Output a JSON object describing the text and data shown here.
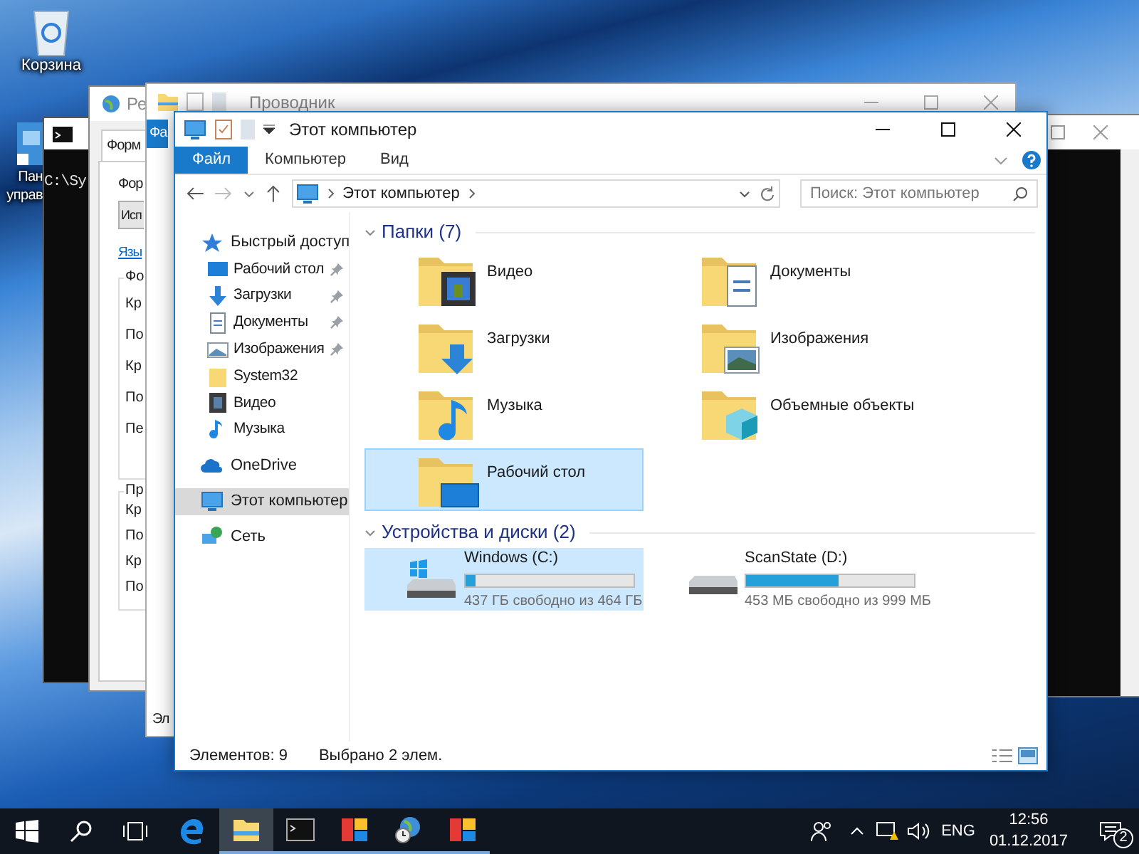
{
  "desktop_icons": [
    {
      "kind": "recycle",
      "lines": [
        "Корзина"
      ]
    },
    {
      "kind": "control",
      "lines": [
        "Пан",
        "управ"
      ]
    }
  ],
  "console_window": {
    "output": "C:\\Sy"
  },
  "region_window": {
    "title": "Ре",
    "tab": "Форм",
    "format_label": "Фор",
    "format_value": "Исп",
    "link": "Язы",
    "groups": [
      {
        "title": "Фо",
        "rows": [
          "Кр",
          "По",
          "Кр",
          "По",
          "Пе"
        ]
      },
      {
        "title": "Пр",
        "rows": [
          "Кр",
          "По",
          "Кр",
          "По"
        ]
      }
    ]
  },
  "explorer_back": {
    "title": "Проводник",
    "file_tab": "Фа",
    "status": "Эл"
  },
  "explorer": {
    "title": "Этот компьютер",
    "ribbon_tabs": [
      {
        "label": "Файл",
        "selected": true
      },
      {
        "label": "Компьютер",
        "selected": false
      },
      {
        "label": "Вид",
        "selected": false
      }
    ],
    "breadcrumb": "Этот компьютер",
    "search": {
      "placeholder": "Поиск: Этот компьютер"
    },
    "nav": [
      {
        "label": "Быстрый доступ",
        "kind": "star",
        "selected": false,
        "children": [
          {
            "label": "Рабочий стол",
            "kind": "desktop",
            "pinned": true
          },
          {
            "label": "Загрузки",
            "kind": "download",
            "pinned": true
          },
          {
            "label": "Документы",
            "kind": "document",
            "pinned": true
          },
          {
            "label": "Изображения",
            "kind": "pictures",
            "pinned": true
          },
          {
            "label": "System32",
            "kind": "folder",
            "pinned": false
          },
          {
            "label": "Видео",
            "kind": "video",
            "pinned": false
          },
          {
            "label": "Музыка",
            "kind": "music",
            "pinned": false
          }
        ]
      },
      {
        "label": "OneDrive",
        "kind": "cloud",
        "selected": false
      },
      {
        "label": "Этот компьютер",
        "kind": "pc",
        "selected": true
      },
      {
        "label": "Сеть",
        "kind": "network",
        "selected": false
      }
    ],
    "folders": {
      "heading": "Папки (7)",
      "items": [
        {
          "name": "Видео",
          "kind": "video",
          "selected": false
        },
        {
          "name": "Документы",
          "kind": "document",
          "selected": false
        },
        {
          "name": "Загрузки",
          "kind": "download",
          "selected": false
        },
        {
          "name": "Изображения",
          "kind": "pictures",
          "selected": false
        },
        {
          "name": "Музыка",
          "kind": "music",
          "selected": false
        },
        {
          "name": "Объемные объекты",
          "kind": "cube",
          "selected": false
        },
        {
          "name": "Рабочий стол",
          "kind": "desktop",
          "selected": true
        }
      ]
    },
    "drives": {
      "heading": "Устройства и диски (2)",
      "items": [
        {
          "name": "Windows (C:)",
          "kind": "system",
          "level": 0.06,
          "free": "437 ГБ свободно из 464 ГБ",
          "selected": true
        },
        {
          "name": "ScanState (D:)",
          "kind": "plain",
          "level": 0.55,
          "free": "453 МБ свободно из 999 МБ",
          "selected": false
        }
      ]
    },
    "status": {
      "count": "Элементов: 9",
      "selection": "Выбрано 2 элем."
    }
  },
  "taskbar": {
    "buttons": [
      {
        "kind": "start",
        "active": false,
        "running": false
      },
      {
        "kind": "search",
        "active": false,
        "running": false
      },
      {
        "kind": "taskview",
        "active": false,
        "running": false
      },
      {
        "kind": "edge",
        "active": false,
        "running": false
      },
      {
        "kind": "explorer",
        "active": true,
        "running": true
      },
      {
        "kind": "console",
        "active": false,
        "running": true
      },
      {
        "kind": "tiles",
        "active": false,
        "running": true
      },
      {
        "kind": "globe",
        "active": false,
        "running": true
      },
      {
        "kind": "tiles",
        "active": false,
        "running": true
      }
    ],
    "language": "ENG",
    "time": "12:56",
    "date": "01.12.2017",
    "notifications": "2"
  }
}
